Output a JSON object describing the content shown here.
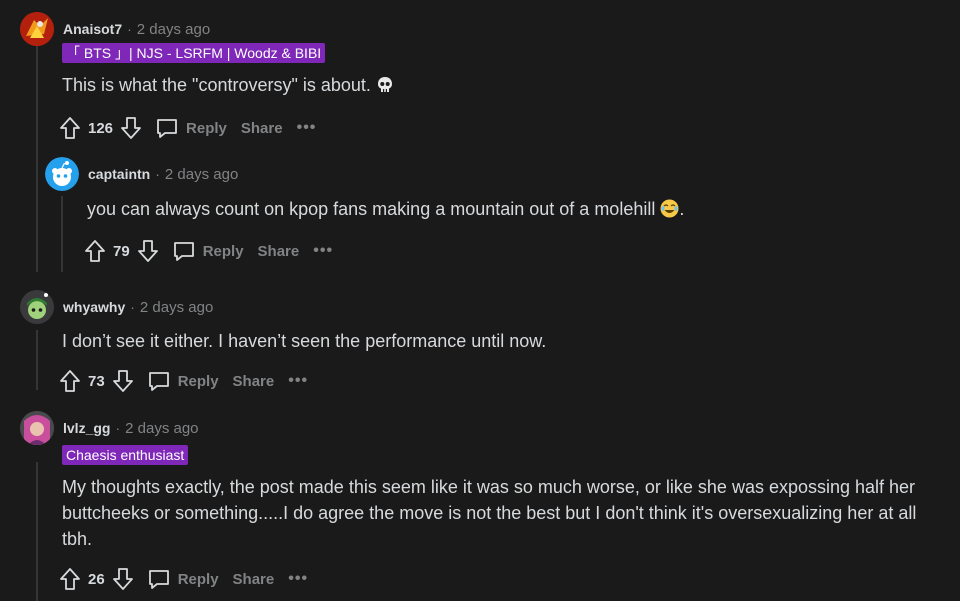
{
  "comments": [
    {
      "author": "Anaisot7",
      "time": "2 days ago",
      "flair": "「 BTS 」| NJS - LSRFM | Woodz & BIBI",
      "body": "This is what the \"controversy\" is about.",
      "emoji": "skull",
      "score": "126",
      "reply_label": "Reply",
      "share_label": "Share",
      "more_label": "•••"
    },
    {
      "author": "captaintn",
      "time": "2 days ago",
      "body": "you can always count on kpop fans making a mountain out of a molehill",
      "body_suffix": ".",
      "emoji": "joy",
      "score": "79",
      "reply_label": "Reply",
      "share_label": "Share",
      "more_label": "•••"
    },
    {
      "author": "whyawhy",
      "time": "2 days ago",
      "body": "I don’t see it either. I haven’t seen the performance until now.",
      "score": "73",
      "reply_label": "Reply",
      "share_label": "Share",
      "more_label": "•••"
    },
    {
      "author": "lvlz_gg",
      "time": "2 days ago",
      "flair": "Chaesis enthusiast",
      "body": "My thoughts exactly, the post made this seem like it was so much worse, or like she was expossing half her buttcheeks or something.....I do agree the move is not the best but I don't think it's oversexualizing her at all tbh.",
      "score": "26",
      "reply_label": "Reply",
      "share_label": "Share",
      "more_label": "•••"
    }
  ],
  "separator": "·",
  "colors": {
    "background": "#1a1a1b",
    "flair": "#7f27b8",
    "muted": "#818384",
    "text": "#d7dadc"
  }
}
